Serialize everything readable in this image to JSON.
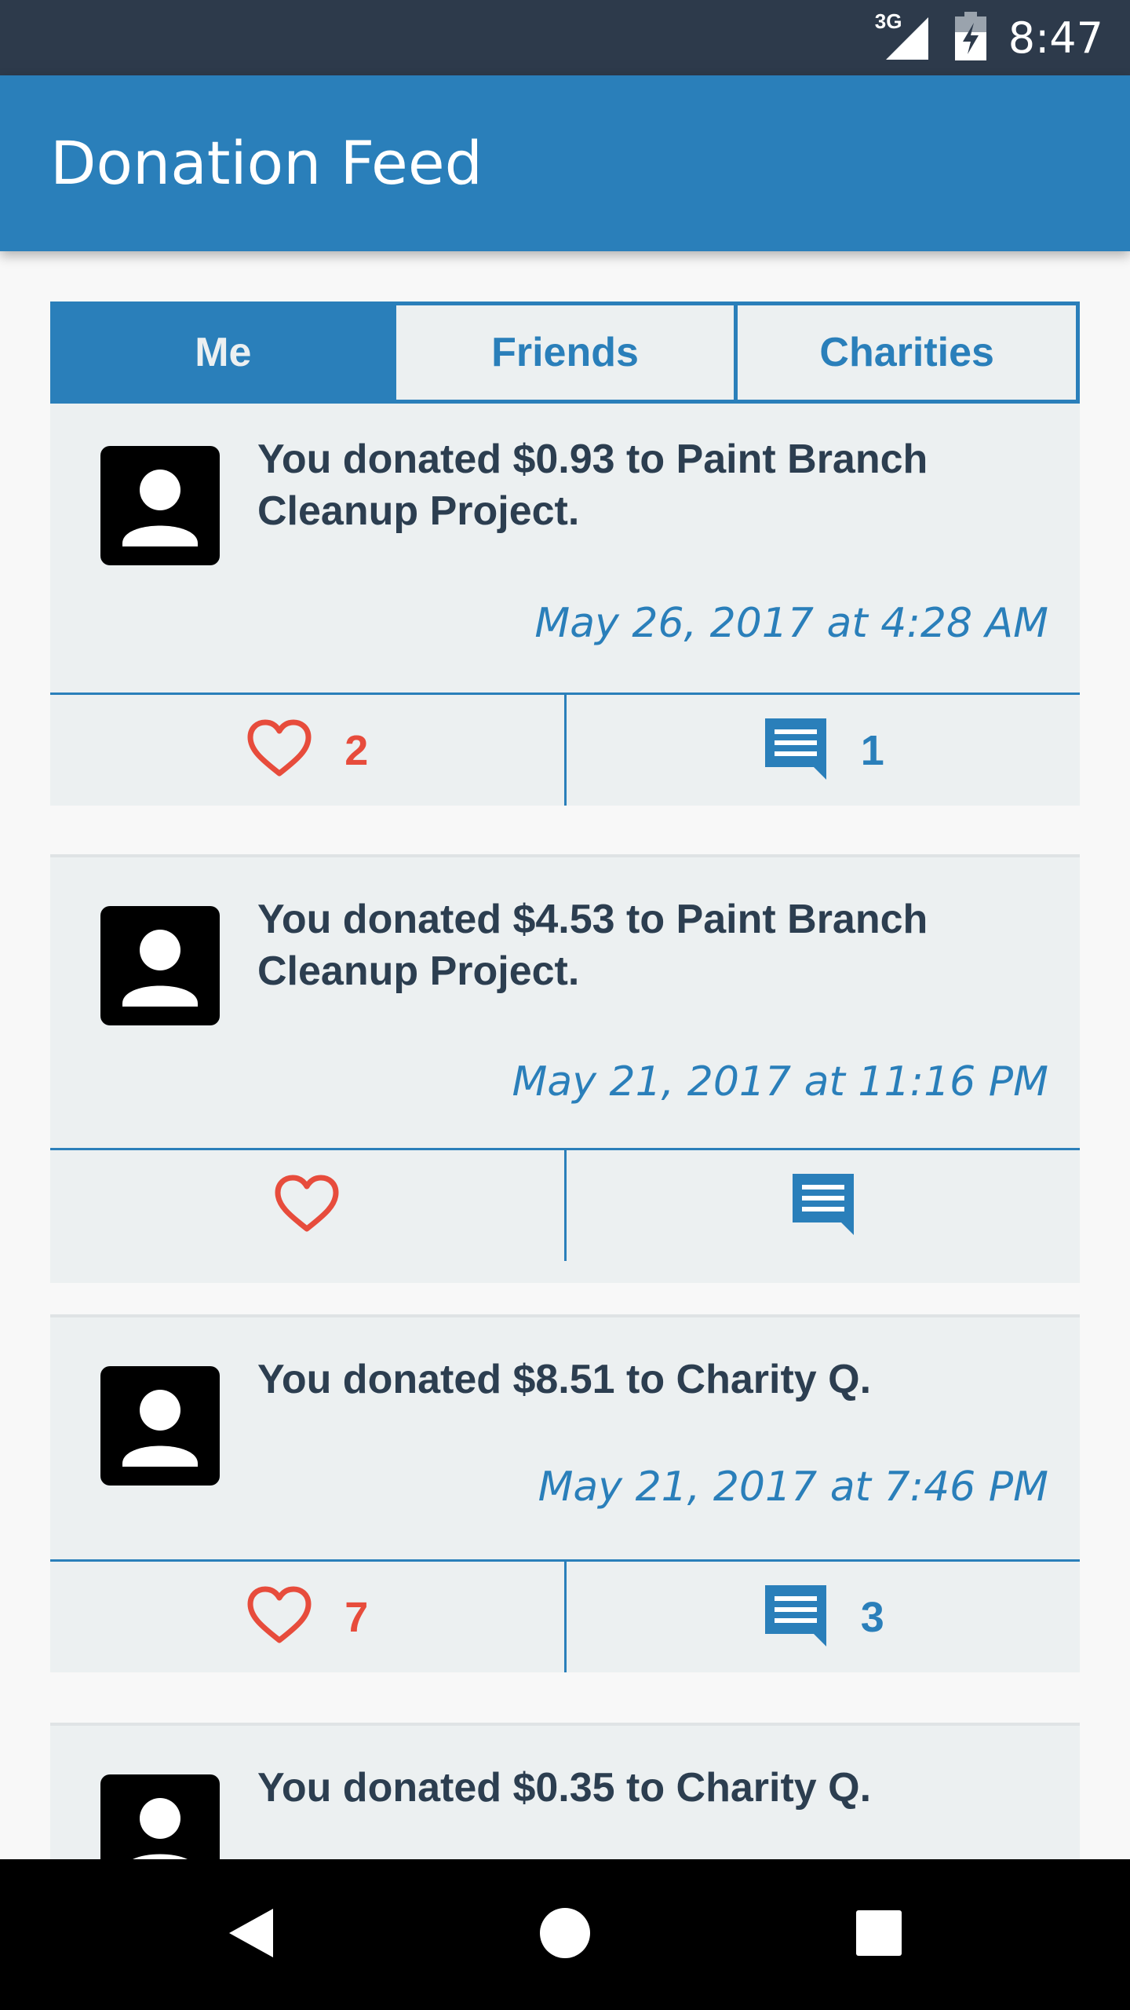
{
  "status_bar": {
    "network": "3G",
    "time": "8:47"
  },
  "app_bar": {
    "title": "Donation Feed"
  },
  "tabs": [
    {
      "label": "Me",
      "active": true
    },
    {
      "label": "Friends",
      "active": false
    },
    {
      "label": "Charities",
      "active": false
    }
  ],
  "feed": [
    {
      "text": "You donated $0.93 to Paint Branch Cleanup Project.",
      "date": "May 26, 2017 at 4:28 AM",
      "likes": "2",
      "comments": "1"
    },
    {
      "text": "You donated $4.53 to Paint Branch Cleanup Project.",
      "date": "May 21, 2017 at 11:16 PM",
      "likes": "",
      "comments": ""
    },
    {
      "text": "You donated $8.51 to Charity Q.",
      "date": "May 21, 2017 at 7:46 PM",
      "likes": "7",
      "comments": "3"
    },
    {
      "text": "You donated $0.35 to Charity Q."
    }
  ],
  "colors": {
    "primary": "#2a7fba",
    "status_bar": "#2d3a4b",
    "card_bg": "#ecf0f1",
    "like": "#e74c3c",
    "text": "#2c3e50"
  },
  "icons": {
    "like": "heart-outline-icon",
    "comment": "comment-icon",
    "avatar": "person-icon",
    "nav_back": "back-triangle-icon",
    "nav_home": "home-circle-icon",
    "nav_recents": "recents-square-icon"
  }
}
